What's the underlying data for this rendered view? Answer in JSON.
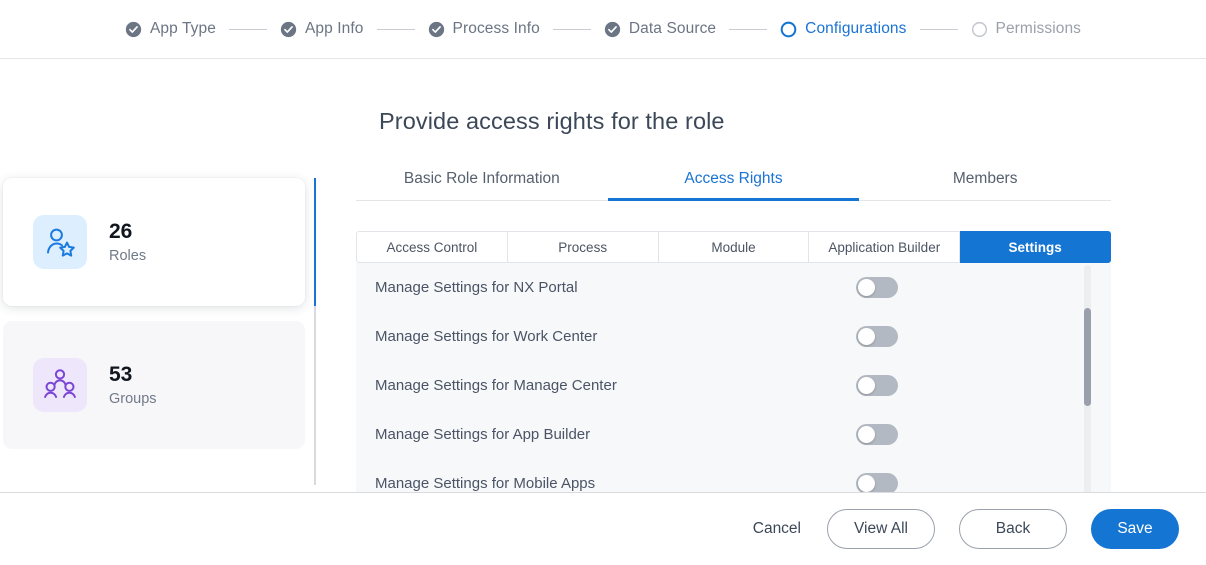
{
  "stepper": {
    "steps": [
      {
        "label": "App Type",
        "state": "done"
      },
      {
        "label": "App Info",
        "state": "done"
      },
      {
        "label": "Process Info",
        "state": "done"
      },
      {
        "label": "Data Source",
        "state": "done"
      },
      {
        "label": "Configurations",
        "state": "current"
      },
      {
        "label": "Permissions",
        "state": "todo"
      }
    ]
  },
  "page": {
    "title": "Provide access rights for the role"
  },
  "sidebar": {
    "cards": [
      {
        "value": "26",
        "label": "Roles",
        "icon": "user-star-icon",
        "selected": true
      },
      {
        "value": "53",
        "label": "Groups",
        "icon": "group-people-icon",
        "selected": false
      }
    ]
  },
  "tabs": [
    {
      "label": "Basic Role Information",
      "active": false
    },
    {
      "label": "Access Rights",
      "active": true
    },
    {
      "label": "Members",
      "active": false
    }
  ],
  "sub_tabs": [
    {
      "label": "Access Control",
      "active": false
    },
    {
      "label": "Process",
      "active": false
    },
    {
      "label": "Module",
      "active": false
    },
    {
      "label": "Application Builder",
      "active": false
    },
    {
      "label": "Settings",
      "active": true
    }
  ],
  "settings_list": [
    {
      "label": "Manage Settings for NX Portal",
      "enabled": false
    },
    {
      "label": "Manage Settings for Work Center",
      "enabled": false
    },
    {
      "label": "Manage Settings for Manage Center",
      "enabled": false
    },
    {
      "label": "Manage Settings for App Builder",
      "enabled": false
    },
    {
      "label": "Manage Settings for Mobile Apps",
      "enabled": false
    }
  ],
  "footer": {
    "cancel": "Cancel",
    "view_all": "View All",
    "back": "Back",
    "save": "Save"
  },
  "colors": {
    "accent": "#1575d3",
    "step_done": "#6b7584",
    "step_todo": "#c6cad0",
    "roles_icon": "#1a7ae0",
    "groups_icon": "#7b45d6"
  }
}
